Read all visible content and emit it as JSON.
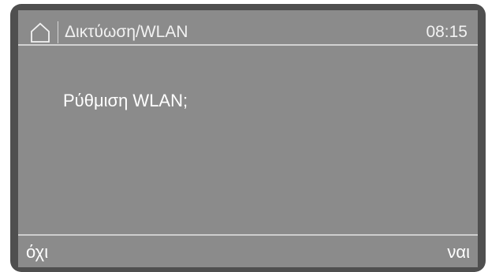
{
  "header": {
    "home_icon": "home-icon",
    "title": "Δικτύωση/WLAN",
    "time": "08:15"
  },
  "dialog": {
    "question": "Ρύθμιση WLAN;"
  },
  "softkeys": {
    "left_label": "όχι",
    "right_label": "ναι"
  },
  "colors": {
    "bezel": "#4f4f4f",
    "screen": "#8b8b8b",
    "text": "#ffffff",
    "divider": "#d2d2d2"
  }
}
